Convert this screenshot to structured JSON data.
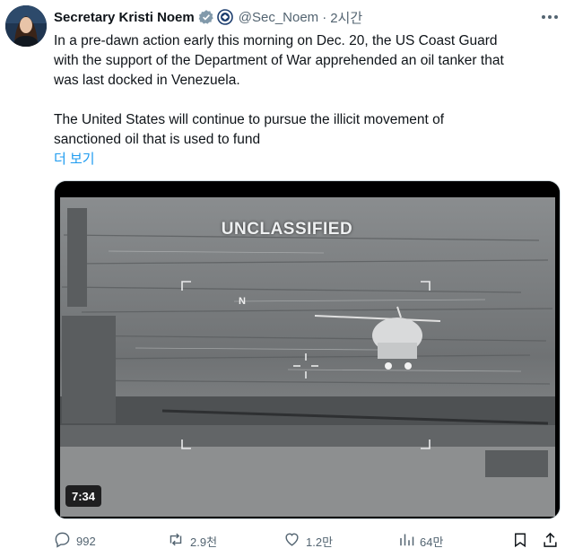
{
  "post": {
    "author_name": "Secretary Kristi Noem",
    "handle": "@Sec_Noem",
    "separator": "·",
    "time": "2시간",
    "text_lines": [
      "In a pre-dawn action early this morning on Dec. 20, the US Coast Guard",
      "with the support of the Department of War apprehended an oil tanker that",
      "was last docked in Venezuela.",
      "The United States will continue to pursue the illicit movement of",
      "sanctioned oil that is used to fund"
    ],
    "show_more": "더 보기"
  },
  "media": {
    "overlay_text": "UNCLASSIFIED",
    "compass_label": "N",
    "duration": "7:34"
  },
  "actions": {
    "replies": "992",
    "reposts": "2.9천",
    "likes": "1.2만",
    "views": "64만"
  },
  "colors": {
    "text": "#0f1419",
    "secondary": "#536471",
    "link": "#1d9bf0",
    "verified": "#829aab"
  },
  "icons": [
    "more-icon",
    "verified-badge-icon",
    "agency-seal-icon",
    "reply-icon",
    "repost-icon",
    "like-icon",
    "views-icon",
    "bookmark-icon",
    "share-icon"
  ]
}
